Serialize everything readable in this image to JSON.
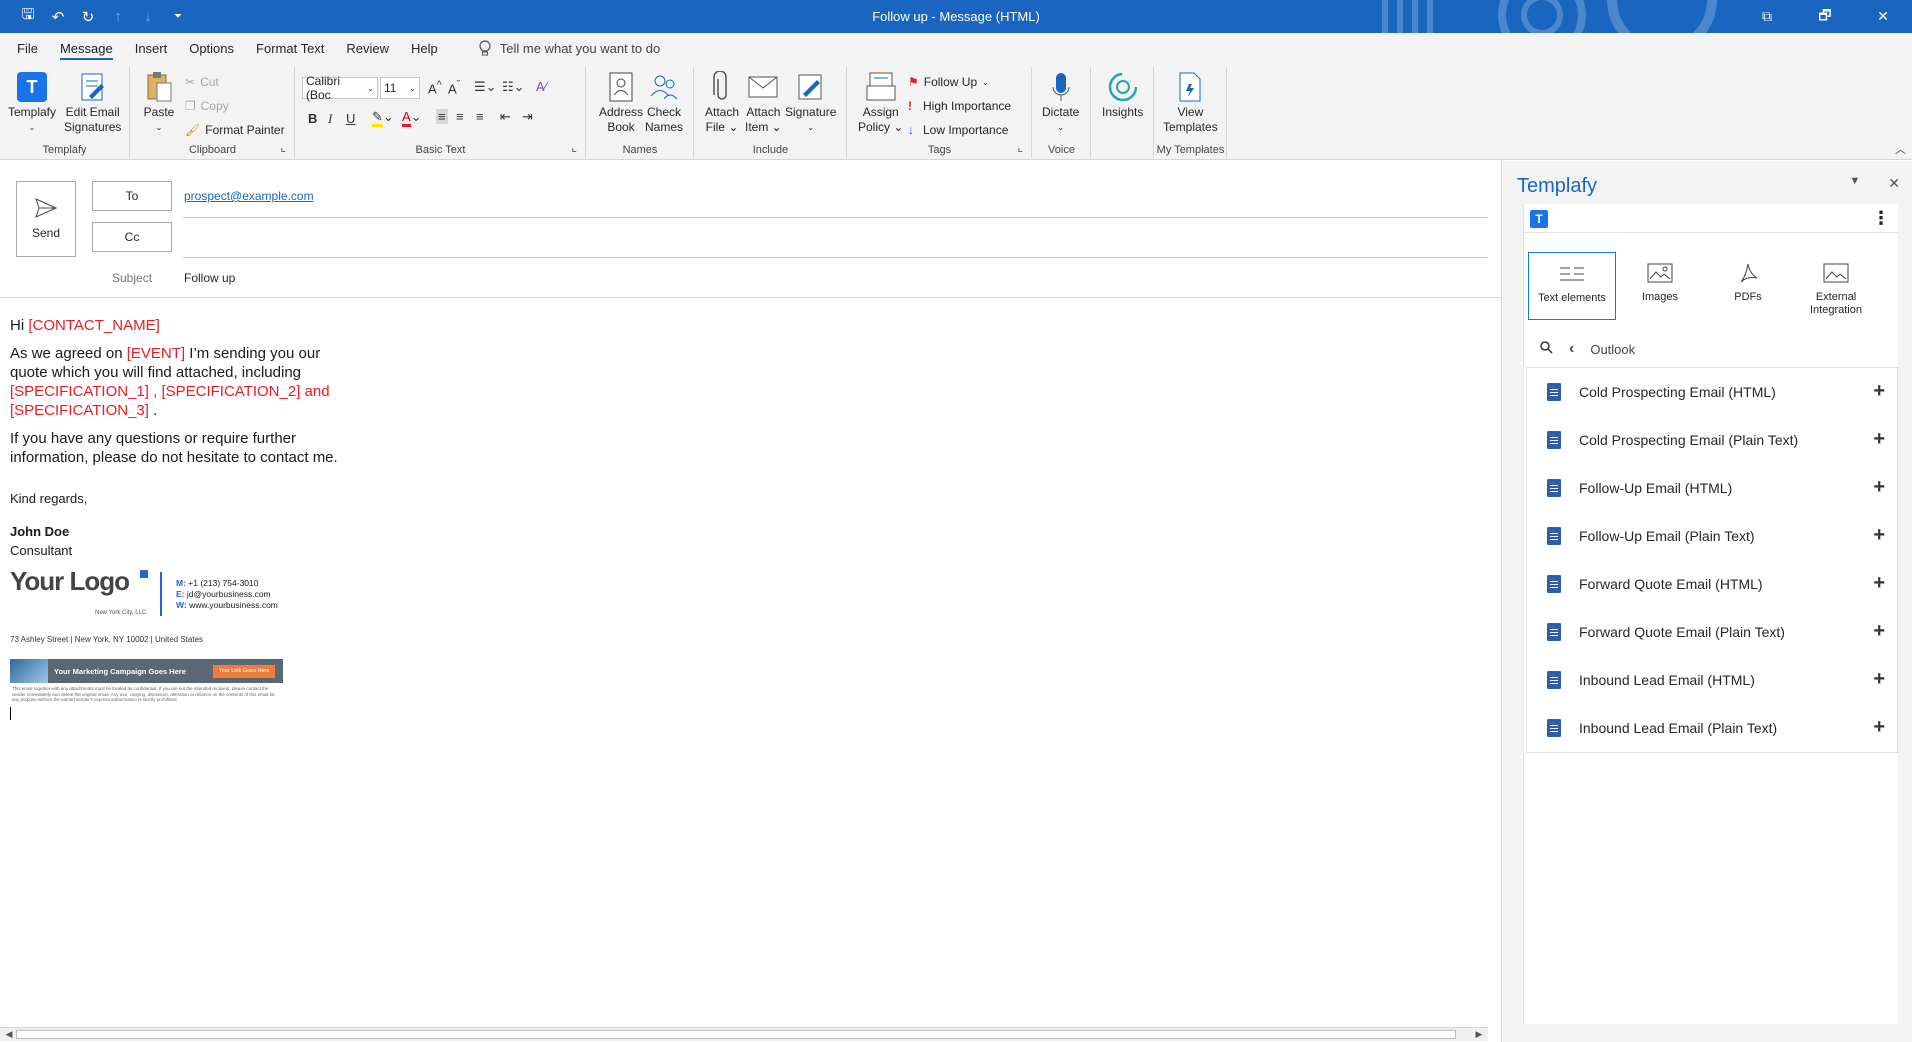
{
  "window": {
    "title": "Follow up  -  Message (HTML)",
    "controls": [
      "⧉",
      "🗗",
      "✕"
    ]
  },
  "menu": {
    "tabs": [
      "File",
      "Message",
      "Insert",
      "Options",
      "Format Text",
      "Review",
      "Help"
    ],
    "active_tab": "Message",
    "tell_me": "Tell me what you want to do"
  },
  "ribbon": {
    "templafy": {
      "button": "Templafy",
      "edit_sig_1": "Edit Email",
      "edit_sig_2": "Signatures",
      "label": "Templafy"
    },
    "clipboard": {
      "paste": "Paste",
      "cut": "Cut",
      "copy": "Copy",
      "format_painter": "Format Painter",
      "label": "Clipboard"
    },
    "basic_text": {
      "font": "Calibri (Boc",
      "size": "11",
      "label": "Basic Text"
    },
    "names": {
      "address_book_1": "Address",
      "address_book_2": "Book",
      "check_names_1": "Check",
      "check_names_2": "Names",
      "label": "Names"
    },
    "include": {
      "attach_file_1": "Attach",
      "attach_file_2": "File",
      "attach_item_1": "Attach",
      "attach_item_2": "Item",
      "signature": "Signature",
      "label": "Include"
    },
    "tags": {
      "assign_policy_1": "Assign",
      "assign_policy_2": "Policy",
      "follow_up": "Follow Up",
      "high": "High Importance",
      "low": "Low Importance",
      "label": "Tags"
    },
    "voice": {
      "dictate": "Dictate",
      "label": "Voice"
    },
    "insights": {
      "button": "Insights"
    },
    "my_templates": {
      "view_1": "View",
      "view_2": "Templates",
      "label": "My Templates"
    }
  },
  "compose": {
    "send": "Send",
    "to_label": "To",
    "cc_label": "Cc",
    "to_value": "prospect@example.com",
    "subject_label": "Subject",
    "subject_value": "Follow up"
  },
  "body": {
    "greeting": "Hi ",
    "contact_name": "[CONTACT_NAME]",
    "p1_a": "As we agreed on ",
    "event": "[EVENT]",
    "p1_b": "  I’m sending you our quote which you will find attached, including ",
    "spec1": "[SPECIFICATION_1]",
    "sep1": " , ",
    "spec2": "[SPECIFICATION_2]",
    "and": "  and ",
    "spec3": "[SPECIFICATION_3]",
    "p1_end": " .",
    "p2": "If you have any questions or require further information, please do not hesitate to contact me.",
    "regards": "Kind regards,",
    "name": "John Doe",
    "role": "Consultant",
    "logo": "Your Logo",
    "logo_sub": "New York City, LLC",
    "phone_label": "M:",
    "phone": "+1 (213) 754-3010",
    "email_label": "E:",
    "email": "jd@yourbusiness.com",
    "web_label": "W:",
    "web": "www.yourbusiness.com",
    "address": "73 Ashley Street | New York, NY 10002 | United States",
    "banner": "Your Marketing Campaign Goes Here",
    "banner_cta": "Your Link Goes Here",
    "disclaimer": "This email together with any attachments must be treated as confidential. If you are not the intended recipient, please contact the sender immediately and delete the original email. Any use, copying, disclosure, alteration or reliance on the contents of this email for any purpose without the named sender's express authorization is strictly prohibited."
  },
  "pane": {
    "title": "Templafy",
    "categories": [
      {
        "label": "Text elements",
        "icon": "text-elements-icon"
      },
      {
        "label": "Images",
        "icon": "image-icon"
      },
      {
        "label": "PDFs",
        "icon": "pdf-icon"
      },
      {
        "label": "External Integration",
        "icon": "external-integration-icon"
      }
    ],
    "breadcrumb": "Outlook",
    "items": [
      "Cold Prospecting Email (HTML)",
      "Cold Prospecting Email (Plain Text)",
      "Follow-Up Email (HTML)",
      "Follow-Up Email (Plain Text)",
      "Forward Quote Email (HTML)",
      "Forward Quote Email (Plain Text)",
      "Inbound Lead Email (HTML)",
      "Inbound Lead Email (Plain Text)"
    ]
  },
  "colors": {
    "accent": "#1a65c0",
    "placeholder": "#e31e24",
    "templafy_blue": "#1a73e8"
  }
}
